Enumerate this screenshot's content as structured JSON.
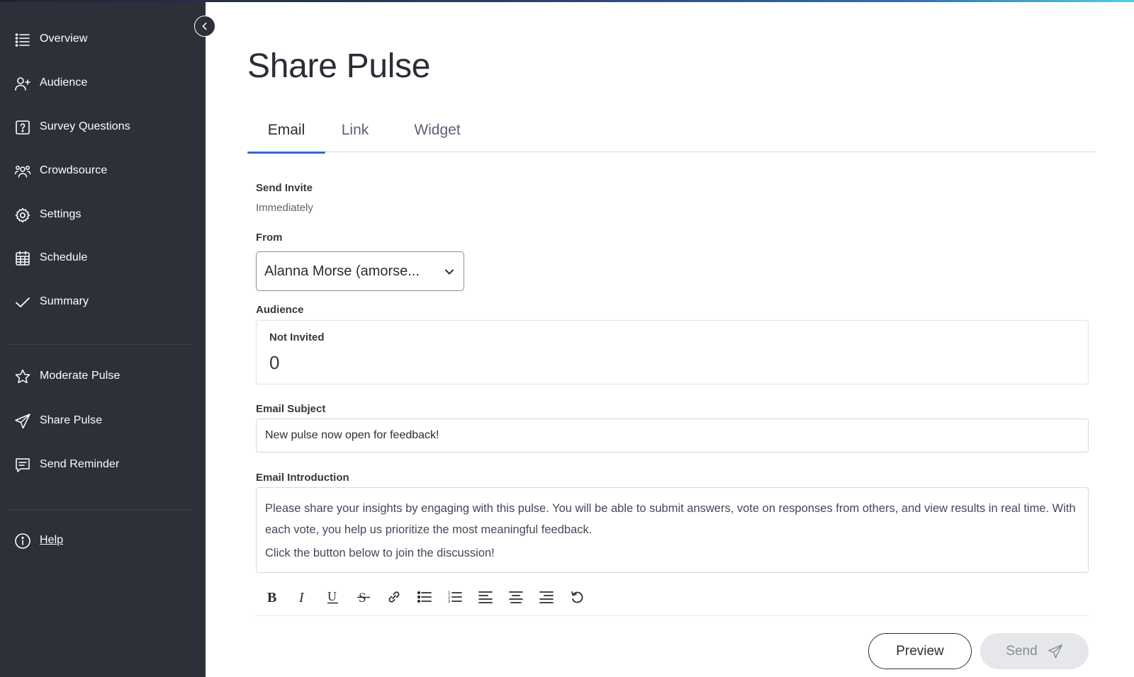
{
  "sidebar": {
    "items": [
      {
        "label": "Overview",
        "icon": "list-icon"
      },
      {
        "label": "Audience",
        "icon": "add-person-icon"
      },
      {
        "label": "Survey Questions",
        "icon": "question-square-icon"
      },
      {
        "label": "Crowdsource",
        "icon": "group-icon"
      },
      {
        "label": "Settings",
        "icon": "gear-icon"
      },
      {
        "label": "Schedule",
        "icon": "calendar-icon"
      },
      {
        "label": "Summary",
        "icon": "check-icon"
      },
      {
        "label": "Moderate Pulse",
        "icon": "star-icon"
      },
      {
        "label": "Share Pulse",
        "icon": "paper-plane-icon"
      },
      {
        "label": "Send Reminder",
        "icon": "message-icon"
      },
      {
        "label": "Help",
        "icon": "info-icon"
      }
    ],
    "collapse_icon": "chevron-left-icon"
  },
  "page": {
    "title": "Share Pulse"
  },
  "tabs": [
    {
      "label": "Email",
      "active": true
    },
    {
      "label": "Link",
      "active": false
    },
    {
      "label": "Widget",
      "active": false
    }
  ],
  "form": {
    "send_invite_label": "Send Invite",
    "send_invite_value": "Immediately",
    "from_label": "From",
    "from_value": "Alanna Morse (amorse...",
    "audience_label": "Audience",
    "not_invited_label": "Not Invited",
    "not_invited_value": "0",
    "email_subject_label": "Email Subject",
    "email_subject_value": "New pulse now open for feedback!",
    "email_intro_label": "Email Introduction",
    "email_intro_p1": "Please share your insights by engaging with this pulse. You will be able to submit answers, vote on responses from others, and view results in real time. With each vote, you help us prioritize the most meaningful feedback.",
    "email_intro_p2": "Click the button below to join the discussion!"
  },
  "toolbar": {
    "buttons": [
      "bold-icon",
      "italic-icon",
      "underline-icon",
      "strikethrough-icon",
      "link-icon",
      "bullet-list-icon",
      "numbered-list-icon",
      "align-left-icon",
      "align-center-icon",
      "align-right-icon",
      "undo-icon"
    ]
  },
  "actions": {
    "preview_label": "Preview",
    "send_label": "Send"
  },
  "colors": {
    "sidebar_bg": "#2e3039",
    "accent": "#2f6bd6",
    "send_disabled_bg": "#e6e7ea"
  }
}
